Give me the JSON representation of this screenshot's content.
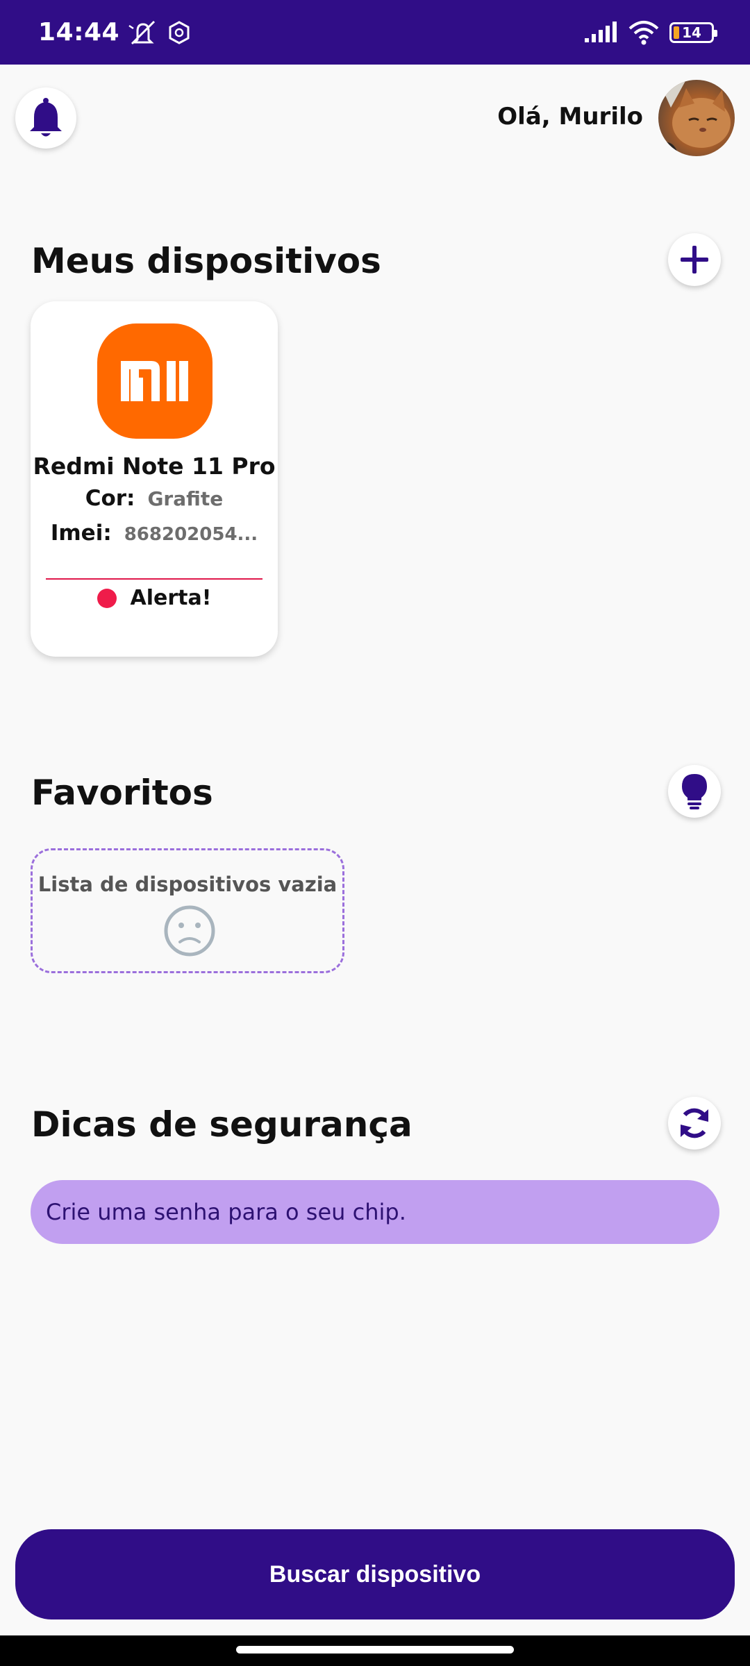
{
  "status_bar": {
    "time": "14:44",
    "battery": "14",
    "icons": [
      "mute-icon",
      "app-shield-icon",
      "signal-icon",
      "wifi-icon",
      "battery-icon"
    ]
  },
  "header": {
    "greeting": "Olá, Murilo",
    "bell_icon": "bell-icon",
    "avatar": "cat-photo"
  },
  "devices": {
    "title": "Meus dispositivos",
    "add_icon": "plus-icon",
    "items": [
      {
        "brand": "Xiaomi",
        "name": "Redmi Note 11 Pro",
        "color_label": "Cor:",
        "color_value": "Grafite",
        "imei_label": "Imei:",
        "imei_value": "868202054...",
        "status": "Alerta!",
        "status_color": "#ef1c4a"
      }
    ]
  },
  "favorites": {
    "title": "Favoritos",
    "icon": "lightbulb-icon",
    "empty_text": "Lista de dispositivos vazia",
    "empty_icon": "sad-face-icon"
  },
  "tips": {
    "title": "Dicas de segurança",
    "icon": "refresh-icon",
    "text": "Crie uma senha para o seu chip."
  },
  "search_button": "Buscar dispositivo",
  "colors": {
    "primary": "#300d87",
    "tip_bg": "#c19ff0",
    "alert": "#ef1c4a",
    "xiaomi_orange": "#ff6900"
  }
}
